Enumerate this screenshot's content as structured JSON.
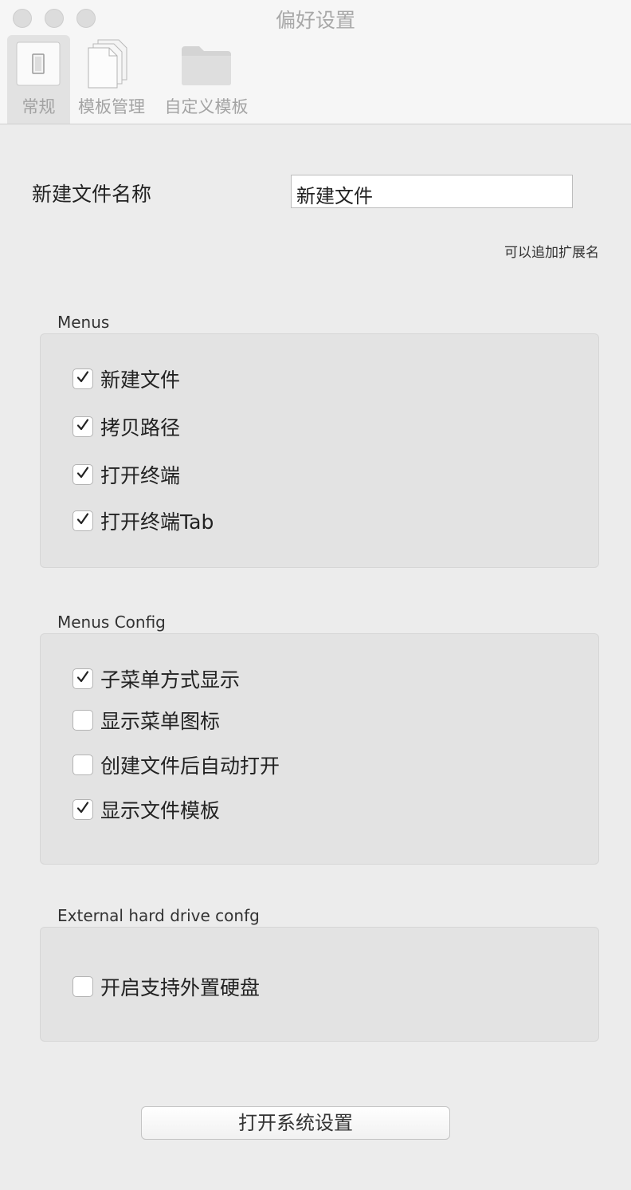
{
  "window": {
    "title": "偏好设置"
  },
  "toolbar": {
    "tabs": [
      {
        "label": "常规",
        "icon": "switch-icon",
        "active": true
      },
      {
        "label": "模板管理",
        "icon": "documents-icon",
        "active": false
      },
      {
        "label": "自定义模板",
        "icon": "folder-icon",
        "active": false
      }
    ]
  },
  "general": {
    "filename_label": "新建文件名称",
    "filename_value": "新建文件",
    "filename_hint": "可以追加扩展名"
  },
  "menus": {
    "title": "Menus",
    "items": [
      {
        "label": "新建文件",
        "checked": true
      },
      {
        "label": "拷贝路径",
        "checked": true
      },
      {
        "label": "打开终端",
        "checked": true
      },
      {
        "label": "打开终端Tab",
        "checked": true
      }
    ]
  },
  "menus_config": {
    "title": "Menus Config",
    "items": [
      {
        "label": "子菜单方式显示",
        "checked": true
      },
      {
        "label": "显示菜单图标",
        "checked": false
      },
      {
        "label": "创建文件后自动打开",
        "checked": false
      },
      {
        "label": "显示文件模板",
        "checked": true
      }
    ]
  },
  "external": {
    "title": "External hard drive confg",
    "items": [
      {
        "label": "开启支持外置硬盘",
        "checked": false
      }
    ]
  },
  "footer": {
    "button_label": "打开系统设置"
  }
}
